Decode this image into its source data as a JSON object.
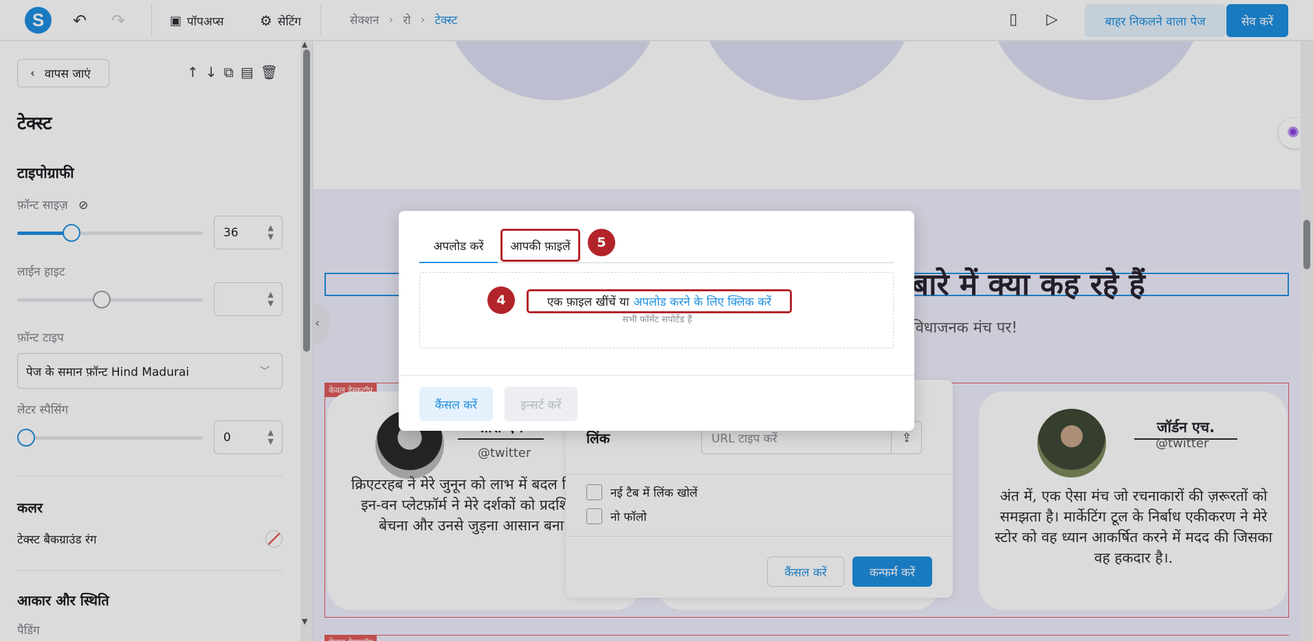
{
  "topbar": {
    "logo": "S",
    "undo_icon": "undo-icon",
    "redo_icon": "redo-icon",
    "popups_label": "पॉपअप्स",
    "settings_label": "सेटिंग",
    "breadcrumb": [
      "सेक्शन",
      "रो",
      "टेक्स्ट"
    ],
    "exit_label": "बाहर निकलने वाला पेज",
    "save_label": "सेव करें"
  },
  "sidebar": {
    "back_label": "वापस जाएं",
    "title": "टेक्स्ट",
    "typography_title": "टाइपोग्राफी",
    "font_size_label": "फ़ॉन्ट साइज़",
    "font_size_value": "36",
    "font_size_level": 0.27,
    "line_height_label": "लाईन हाइट",
    "line_height_value": "",
    "line_height_level": 0.45,
    "font_type_label": "फ़ॉन्ट टाइप",
    "font_type_value": "पेज के समान फ़ॉन्ट Hind Madurai",
    "letter_spacing_label": "लेटर स्पैसिंग",
    "letter_spacing_value": "0",
    "letter_spacing_level": 0,
    "color_title": "कलर",
    "text_bg_label": "टेक्स्ट बैकग्राउंड रंग",
    "size_position_title": "आकार और स्थिति",
    "padding_label": "पैडिंग"
  },
  "canvas": {
    "heading": "बारे में क्या कह रहे हैं",
    "subheading": "विधाजनक मंच पर!",
    "desktop_only_badge": "केवल डेस्कटॉप",
    "cards": [
      {
        "name": "सारा एम",
        "handle": "@twitter",
        "text": "क्रिएटरहब ने मेरे जुनून को लाभ में बदल दिया। ऑल-इन-वन प्लेटफ़ॉर्म ने मेरे दर्शकों को प्रदर्शित करना, बेचना और उनसे जुड़ना आसान बना दिया।"
      },
      {
        "name": "जॉर्डन एच.",
        "handle": "@twitter",
        "text": "अंत में, एक ऐसा मंच जो रचनाकारों की ज़रूरतों को समझता है। मार्केटिंग टूल के निर्बाध एकीकरण ने मेरे स्टोर को वह ध्यान आकर्षित करने में मदद की जिसका वह हकदार है।."
      }
    ]
  },
  "link_panel": {
    "label": "लिंक",
    "url_placeholder": "URL टाइप करें",
    "new_tab_label": "नई टैब में लिंक खोलें",
    "nofollow_label": "नो फॉलो",
    "cancel_label": "कैंसल करें",
    "confirm_label": "कन्फर्म करें"
  },
  "modal": {
    "tab_upload": "अपलोड करें",
    "tab_files": "आपकी फ़ाइलें",
    "marker_tab": "5",
    "marker_drop": "4",
    "drop_text": "एक फ़ाइल खींचें या",
    "drop_link": "अपलोड करने के लिए क्लिक करें",
    "drop_sub": "सभी फॉर्मेट सपोर्टेड हैं",
    "cancel_label": "कैंसल करें",
    "insert_label": "इन्सर्ट करें"
  },
  "colors": {
    "accent": "#1f8fe0",
    "marker": "#b3242a",
    "desktop_badge": "#e05a5a"
  }
}
